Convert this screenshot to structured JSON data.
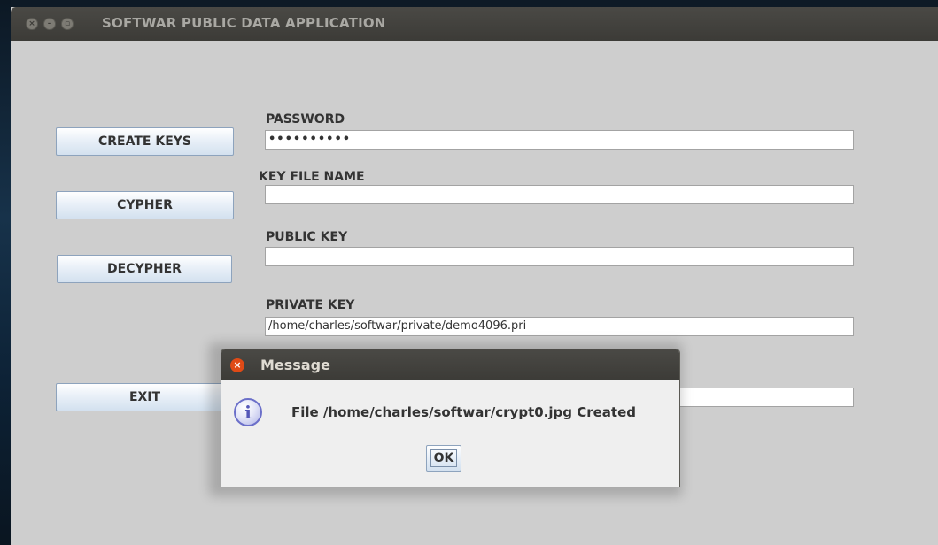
{
  "window": {
    "title": "SOFTWAR PUBLIC DATA APPLICATION"
  },
  "buttons": {
    "create_keys": "CREATE KEYS",
    "cypher": "CYPHER",
    "decypher": "DECYPHER",
    "exit": "EXIT"
  },
  "fields": {
    "password_label": "PASSWORD",
    "password_value": "••••••••••",
    "key_file_name_label": "KEY FILE NAME",
    "key_file_name_value": "",
    "public_key_label": "PUBLIC KEY",
    "public_key_value": "",
    "private_key_label": "PRIVATE KEY",
    "private_key_value": "/home/charles/softwar/private/demo4096.pri",
    "fifth_field_value": ""
  },
  "dialog": {
    "title": "Message",
    "message": "File /home/charles/softwar/crypt0.jpg Created",
    "ok_label": "OK",
    "icon_glyph": "i",
    "close_glyph": "×"
  },
  "icons": {
    "window_close": "×",
    "window_minimize": "–",
    "window_maximize": "▫"
  },
  "colors": {
    "titlebar": "#3c3b37",
    "window_bg": "#cecece",
    "dialog_close": "#df4a16",
    "info_icon": "#6b6fc9"
  }
}
